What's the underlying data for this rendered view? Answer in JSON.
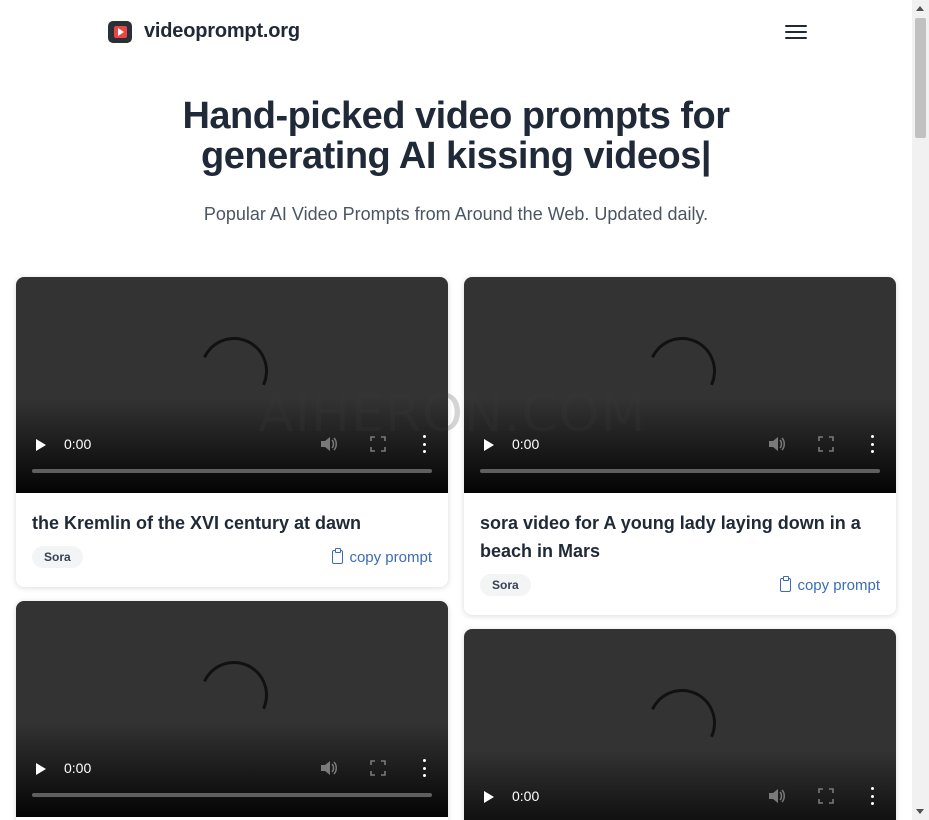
{
  "header": {
    "site_name": "videoprompt.org",
    "logo_icon": "play-logo-icon",
    "menu_icon": "hamburger-menu-icon"
  },
  "hero": {
    "title_line1": "Hand-picked video prompts for",
    "title_line2": "generating AI kissing videos|",
    "subtitle": "Popular AI Video Prompts from Around the Web. Updated daily."
  },
  "watermark": "AIHERON.COM",
  "video_player": {
    "time": "0:00",
    "progress": 0
  },
  "cards": [
    {
      "title": "the Kremlin of the XVI century at dawn",
      "badge": "Sora",
      "copy_label": "copy prompt"
    },
    {
      "title": "sora video for A young lady laying down in a beach in Mars",
      "badge": "Sora",
      "copy_label": "copy prompt"
    },
    {
      "title": "",
      "badge": "",
      "copy_label": ""
    },
    {
      "title": "",
      "badge": "",
      "copy_label": ""
    }
  ],
  "colors": {
    "accent_link": "#3b6cb5",
    "text": "#1f2937",
    "logo_red": "#ef4444"
  }
}
